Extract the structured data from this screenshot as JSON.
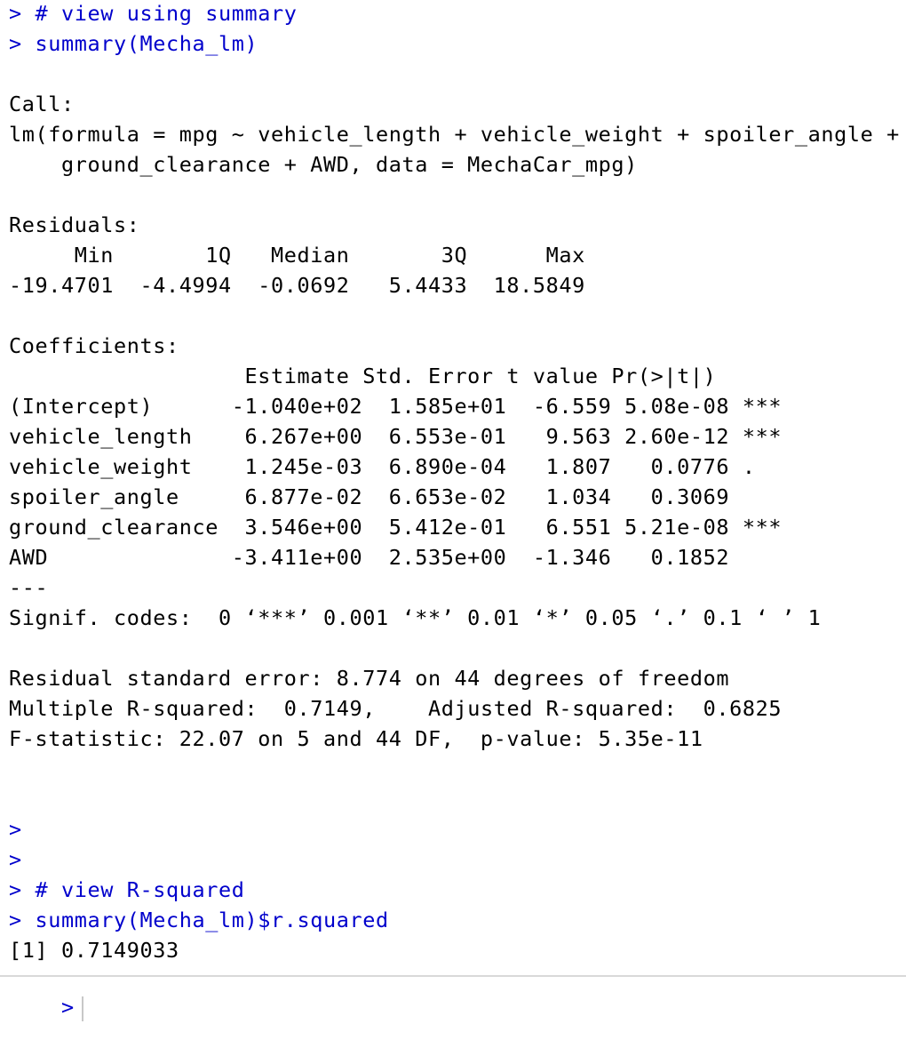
{
  "console": {
    "lines": [
      {
        "kind": "cmd",
        "text": "> # view using summary"
      },
      {
        "kind": "cmd",
        "text": "> summary(Mecha_lm)"
      },
      {
        "kind": "out",
        "text": ""
      },
      {
        "kind": "out",
        "text": "Call:"
      },
      {
        "kind": "out",
        "text": "lm(formula = mpg ~ vehicle_length + vehicle_weight + spoiler_angle +"
      },
      {
        "kind": "out",
        "text": "    ground_clearance + AWD, data = MechaCar_mpg)"
      },
      {
        "kind": "out",
        "text": ""
      },
      {
        "kind": "out",
        "text": "Residuals:"
      },
      {
        "kind": "out",
        "text": "     Min       1Q   Median       3Q      Max "
      },
      {
        "kind": "out",
        "text": "-19.4701  -4.4994  -0.0692   5.4433  18.5849 "
      },
      {
        "kind": "out",
        "text": ""
      },
      {
        "kind": "out",
        "text": "Coefficients:"
      },
      {
        "kind": "out",
        "text": "                  Estimate Std. Error t value Pr(>|t|)    "
      },
      {
        "kind": "out",
        "text": "(Intercept)      -1.040e+02  1.585e+01  -6.559 5.08e-08 ***"
      },
      {
        "kind": "out",
        "text": "vehicle_length    6.267e+00  6.553e-01   9.563 2.60e-12 ***"
      },
      {
        "kind": "out",
        "text": "vehicle_weight    1.245e-03  6.890e-04   1.807   0.0776 .  "
      },
      {
        "kind": "out",
        "text": "spoiler_angle     6.877e-02  6.653e-02   1.034   0.3069    "
      },
      {
        "kind": "out",
        "text": "ground_clearance  3.546e+00  5.412e-01   6.551 5.21e-08 ***"
      },
      {
        "kind": "out",
        "text": "AWD              -3.411e+00  2.535e+00  -1.346   0.1852    "
      },
      {
        "kind": "out",
        "text": "---"
      },
      {
        "kind": "out",
        "text": "Signif. codes:  0 ‘***’ 0.001 ‘**’ 0.01 ‘*’ 0.05 ‘.’ 0.1 ‘ ’ 1"
      },
      {
        "kind": "out",
        "text": ""
      },
      {
        "kind": "out",
        "text": "Residual standard error: 8.774 on 44 degrees of freedom"
      },
      {
        "kind": "out",
        "text": "Multiple R-squared:  0.7149,\tAdjusted R-squared:  0.6825 "
      },
      {
        "kind": "out",
        "text": "F-statistic: 22.07 on 5 and 44 DF,  p-value: 5.35e-11"
      },
      {
        "kind": "out",
        "text": ""
      },
      {
        "kind": "out",
        "text": ""
      },
      {
        "kind": "cmd",
        "text": ">"
      },
      {
        "kind": "cmd",
        "text": ">"
      },
      {
        "kind": "cmd",
        "text": "> # view R-squared"
      },
      {
        "kind": "cmd",
        "text": "> summary(Mecha_lm)$r.squared"
      },
      {
        "kind": "out",
        "text": "[1] 0.7149033"
      }
    ],
    "prompt": ">"
  },
  "colors": {
    "command": "#0000cc",
    "output": "#000000",
    "background": "#ffffff"
  }
}
